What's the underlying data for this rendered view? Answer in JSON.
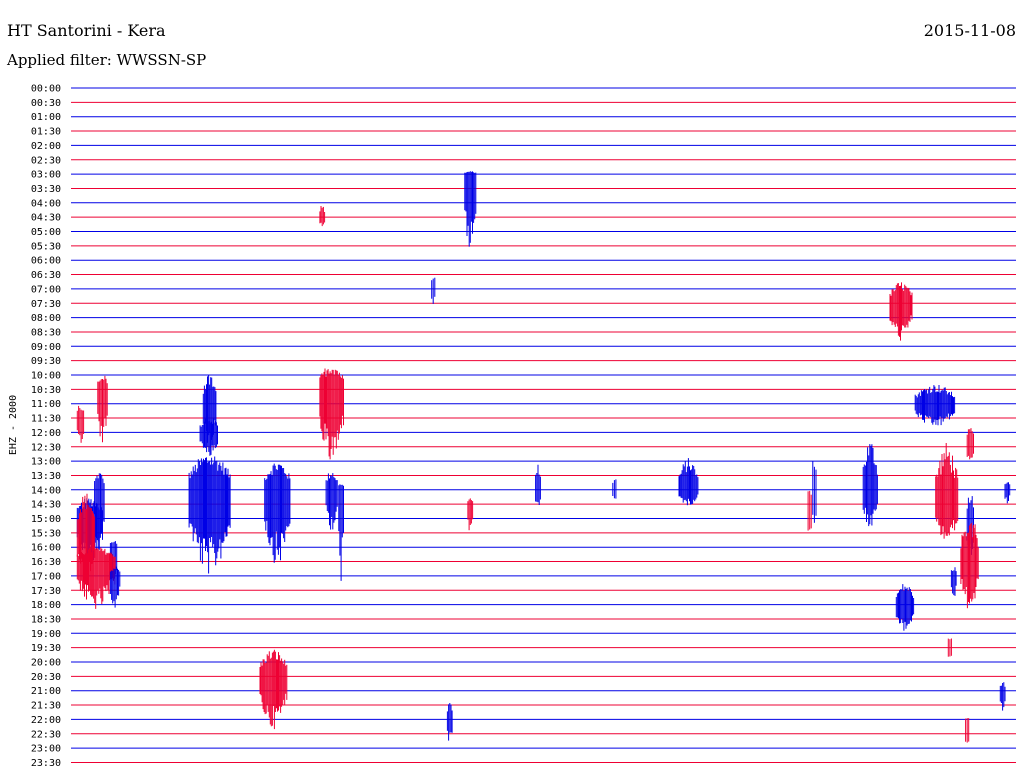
{
  "header": {
    "title": "HT Santorini - Kera",
    "date": "2015-11-08",
    "filter": "Applied filter: WWSSN-SP"
  },
  "chart_data": {
    "type": "line",
    "ylabel": "EHZ - 2000",
    "colors": {
      "odd": "#0000e6",
      "even": "#ee0033"
    },
    "rows": [
      "00:00",
      "00:30",
      "01:00",
      "01:30",
      "02:00",
      "02:30",
      "03:00",
      "03:30",
      "04:00",
      "04:30",
      "05:00",
      "05:30",
      "06:00",
      "06:30",
      "07:00",
      "07:30",
      "08:00",
      "08:30",
      "09:00",
      "09:30",
      "10:00",
      "10:30",
      "11:00",
      "11:30",
      "12:00",
      "12:30",
      "13:00",
      "13:30",
      "14:00",
      "14:30",
      "15:00",
      "15:30",
      "16:00",
      "16:30",
      "17:00",
      "17:30",
      "18:00",
      "18:30",
      "19:00",
      "19:30",
      "20:00",
      "20:30",
      "21:00",
      "21:30",
      "22:00",
      "22:30",
      "23:00",
      "23:30"
    ],
    "events": [
      {
        "row": 28,
        "minute": 1.5,
        "up": 1.9,
        "down": 6.5,
        "dur": 0.6
      },
      {
        "row": 28,
        "minute": 7.5,
        "up": 3.8,
        "down": 8.6,
        "dur": 2.6
      },
      {
        "row": 28,
        "minute": 12.3,
        "up": 3.0,
        "down": 7.6,
        "dur": 1.6
      },
      {
        "row": 28,
        "minute": 17.0,
        "up": 0.8,
        "down": 9.6,
        "dur": 0.3
      },
      {
        "row": 28,
        "minute": 34.4,
        "up": 1.6,
        "down": 1.4,
        "dur": 0.2
      },
      {
        "row": 28,
        "minute": 16.2,
        "up": 2.1,
        "down": 4.1,
        "dur": 0.7
      },
      {
        "row": 28,
        "minute": 29.5,
        "up": 2.8,
        "down": 2.2,
        "dur": 0.3
      },
      {
        "row": 28,
        "minute": 38.6,
        "up": 3.2,
        "down": 1.6,
        "dur": 1.2
      },
      {
        "row": 28,
        "minute": 47.1,
        "up": 4.1,
        "down": 3.9,
        "dur": 0.2
      },
      {
        "row": 28,
        "minute": 50.3,
        "up": 5.1,
        "down": 4.0,
        "dur": 0.9
      },
      {
        "row": 28,
        "minute": 59.3,
        "up": 1.1,
        "down": 1.5,
        "dur": 0.3
      },
      {
        "row": 29,
        "minute": 54.9,
        "up": 6.2,
        "down": 3.7,
        "dur": 1.4
      },
      {
        "row": 30,
        "minute": 0.4,
        "up": 2.2,
        "down": 4.6,
        "dur": 1.6
      },
      {
        "row": 30,
        "minute": 56.9,
        "up": 2.9,
        "down": 4.3,
        "dur": 0.4
      },
      {
        "row": 31,
        "minute": 0.4,
        "up": 4.1,
        "down": 5.3,
        "dur": 1.1
      },
      {
        "row": 32,
        "minute": 2.5,
        "up": 0.8,
        "down": 4.2,
        "dur": 0.4
      },
      {
        "row": 33,
        "minute": 0.4,
        "up": 1.5,
        "down": 4.9,
        "dur": 2.4
      },
      {
        "row": 34,
        "minute": 2.5,
        "up": 1.0,
        "down": 3.5,
        "dur": 0.6
      },
      {
        "row": 41,
        "minute": 12.0,
        "up": 2.8,
        "down": 5.3,
        "dur": 1.7
      },
      {
        "row": 42,
        "minute": 59.0,
        "up": 1.0,
        "down": 2.0,
        "dur": 0.3
      },
      {
        "row": 44,
        "minute": 23.9,
        "up": 1.7,
        "down": 2.4,
        "dur": 0.3
      },
      {
        "row": 45,
        "minute": 56.8,
        "up": 2.2,
        "down": 1.3,
        "dur": 0.2
      },
      {
        "row": 6,
        "minute": 25.0,
        "up": 0.3,
        "down": 7.8,
        "dur": 0.7
      },
      {
        "row": 9,
        "minute": 15.8,
        "up": 1.4,
        "down": 1.1,
        "dur": 0.3
      },
      {
        "row": 14,
        "minute": 22.9,
        "up": 1.6,
        "down": 1.9,
        "dur": 0.2
      },
      {
        "row": 15,
        "minute": 52.0,
        "up": 2.2,
        "down": 3.8,
        "dur": 1.4
      },
      {
        "row": 21,
        "minute": 15.8,
        "up": 2.7,
        "down": 7.6,
        "dur": 1.5
      },
      {
        "row": 21,
        "minute": 1.7,
        "up": 1.8,
        "down": 5.6,
        "dur": 0.6
      },
      {
        "row": 22,
        "minute": 53.6,
        "up": 2.0,
        "down": 2.4,
        "dur": 2.5
      },
      {
        "row": 22,
        "minute": 8.4,
        "up": 3.0,
        "down": 4.6,
        "dur": 0.8
      },
      {
        "row": 23,
        "minute": 0.4,
        "up": 1.5,
        "down": 2.8,
        "dur": 0.4
      },
      {
        "row": 24,
        "minute": 8.2,
        "up": 1.7,
        "down": 2.5,
        "dur": 1.1
      },
      {
        "row": 25,
        "minute": 56.9,
        "up": 2.3,
        "down": 1.9,
        "dur": 0.4
      },
      {
        "row": 29,
        "minute": 25.2,
        "up": 0.6,
        "down": 3.0,
        "dur": 0.3
      },
      {
        "row": 29,
        "minute": 46.8,
        "up": 1.8,
        "down": 4.0,
        "dur": 0.2
      },
      {
        "row": 31,
        "minute": 57.2,
        "up": 1.2,
        "down": 1.0,
        "dur": 0.2
      },
      {
        "row": 33,
        "minute": 56.5,
        "up": 4.6,
        "down": 4.9,
        "dur": 1.1
      },
      {
        "row": 34,
        "minute": 55.9,
        "up": 1.0,
        "down": 2.4,
        "dur": 0.3
      },
      {
        "row": 36,
        "minute": 52.4,
        "up": 2.2,
        "down": 2.7,
        "dur": 1.1
      },
      {
        "row": 39,
        "minute": 55.7,
        "up": 1.3,
        "down": 1.6,
        "dur": 0.2
      }
    ],
    "xlim": [
      0,
      60
    ]
  }
}
